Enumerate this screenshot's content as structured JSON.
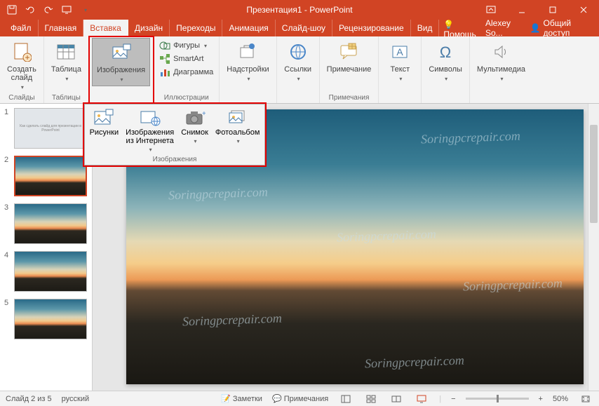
{
  "title": "Презентация1 - PowerPoint",
  "tabs": {
    "file": "Файл",
    "home": "Главная",
    "insert": "Вставка",
    "design": "Дизайн",
    "transitions": "Переходы",
    "animations": "Анимация",
    "slideshow": "Слайд-шоу",
    "review": "Рецензирование",
    "view": "Вид",
    "help": "Помощь"
  },
  "user": "Alexey So...",
  "share": "Общий доступ",
  "ribbon": {
    "slides": {
      "new_slide": "Создать\nслайд",
      "group": "Слайды"
    },
    "tables": {
      "table": "Таблица",
      "group": "Таблицы"
    },
    "images": {
      "btn": "Изображения",
      "group": "Изображения"
    },
    "illustr": {
      "shapes": "Фигуры",
      "smartart": "SmartArt",
      "chart": "Диаграмма",
      "group": "Иллюстрации"
    },
    "addins": {
      "btn": "Надстройки"
    },
    "links": {
      "btn": "Ссылки"
    },
    "comments": {
      "btn": "Примечание",
      "group": "Примечания"
    },
    "text": {
      "btn": "Текст"
    },
    "symbols": {
      "btn": "Символы"
    },
    "media": {
      "btn": "Мультимедиа"
    }
  },
  "dropdown": {
    "pictures": "Рисунки",
    "online": "Изображения\nиз Интернета",
    "screenshot": "Снимок",
    "album": "Фотоальбом",
    "group": "Изображения"
  },
  "slides": [
    {
      "n": "1",
      "kind": "text"
    },
    {
      "n": "2",
      "kind": "photo",
      "selected": true
    },
    {
      "n": "3",
      "kind": "photo"
    },
    {
      "n": "4",
      "kind": "photo"
    },
    {
      "n": "5",
      "kind": "photo"
    }
  ],
  "watermark": "Soringpcrepair.com",
  "status": {
    "slide": "Слайд 2 из 5",
    "lang": "русский",
    "notes": "Заметки",
    "comments": "Примечания",
    "zoom": "50%"
  }
}
